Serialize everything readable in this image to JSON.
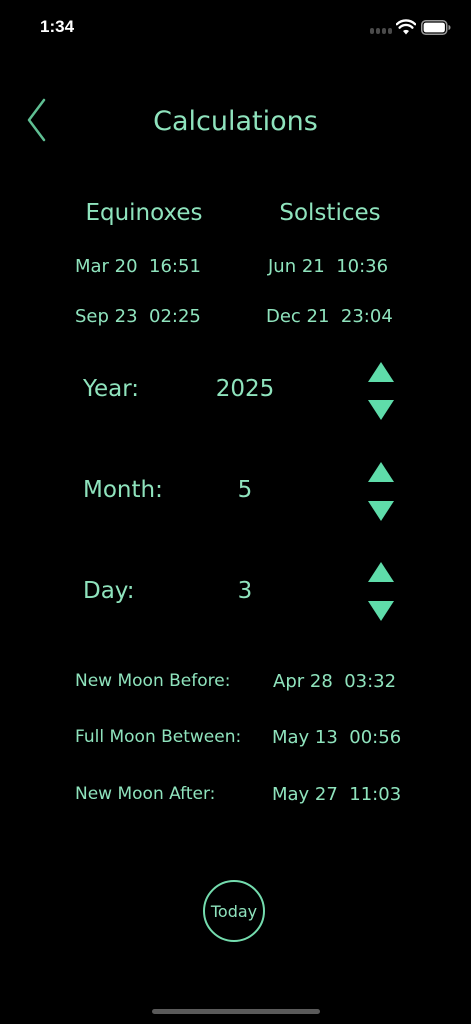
{
  "status_bar": {
    "time": "1:34"
  },
  "nav": {
    "title": "Calculations",
    "back_icon": "chevron-left-icon"
  },
  "seasons": {
    "equinoxes_header": "Equinoxes",
    "solstices_header": "Solstices",
    "equinox_1": "Mar 20  16:51",
    "equinox_2": "Sep 23  02:25",
    "solstice_1": "Jun 21  10:36",
    "solstice_2": "Dec 21  23:04"
  },
  "date_picker": {
    "year_label": "Year:",
    "year_value": "2025",
    "month_label": "Month:",
    "month_value": "5",
    "day_label": "Day:",
    "day_value": "3"
  },
  "moon_phases": {
    "new_moon_before_label": "New Moon Before:",
    "new_moon_before_value": "Apr 28  03:32",
    "full_moon_between_label": "Full Moon Between:",
    "full_moon_between_value": "May 13  00:56",
    "new_moon_after_label": "New Moon After:",
    "new_moon_after_value": "May 27  11:03"
  },
  "today_button": {
    "label": "Today"
  },
  "colors": {
    "background": "#000000",
    "accent": "#8fe3bd",
    "arrow": "#5fdcaa"
  }
}
